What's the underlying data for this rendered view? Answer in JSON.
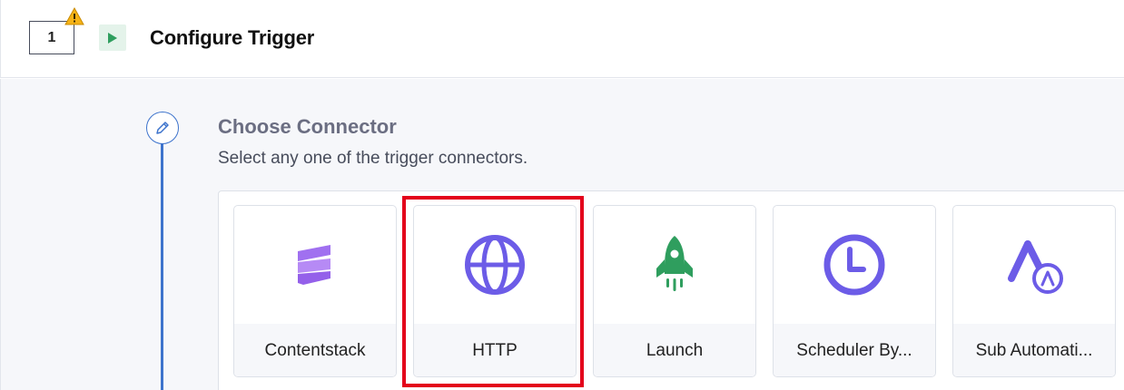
{
  "step": {
    "number": "1",
    "warning_icon": "warning-triangle-icon",
    "play_icon": "play-icon",
    "title": "Configure Trigger"
  },
  "section": {
    "edit_icon": "pencil-icon",
    "title": "Choose Connector",
    "subtitle": "Select any one of the trigger connectors."
  },
  "connectors": [
    {
      "label": "Contentstack",
      "icon": "contentstack-icon",
      "color": "#9f6af3"
    },
    {
      "label": "HTTP",
      "icon": "globe-icon",
      "color": "#6c5ce7",
      "highlighted": true
    },
    {
      "label": "Launch",
      "icon": "rocket-icon",
      "color": "#2f9e5e"
    },
    {
      "label": "Scheduler By...",
      "icon": "clock-icon",
      "color": "#6c5ce7"
    },
    {
      "label": "Sub Automati...",
      "icon": "sub-automation-icon",
      "color": "#6c5ce7"
    }
  ],
  "colors": {
    "accent": "#3d73cc",
    "highlight": "#e3001b",
    "play": "#2f9e5e"
  }
}
